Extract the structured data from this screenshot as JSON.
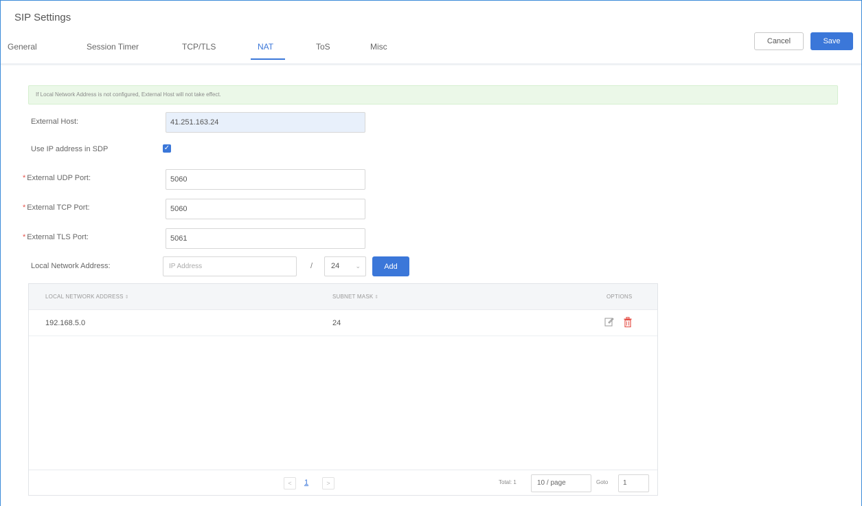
{
  "page": {
    "title": "SIP Settings"
  },
  "tabs": [
    {
      "label": "General"
    },
    {
      "label": "Session Timer"
    },
    {
      "label": "TCP/TLS"
    },
    {
      "label": "NAT"
    },
    {
      "label": "ToS"
    },
    {
      "label": "Misc"
    }
  ],
  "active_tab": "NAT",
  "actions": {
    "cancel_label": "Cancel",
    "save_label": "Save"
  },
  "notice": "If Local Network Address is not configured, External Host will not take effect.",
  "form": {
    "external_host": {
      "label": "External Host:",
      "value": "41.251.163.24"
    },
    "use_ip_sdp": {
      "label": "Use IP address in SDP",
      "checked": true
    },
    "udp_port": {
      "required_mark": "*",
      "label": "External UDP Port:",
      "value": "5060"
    },
    "tcp_port": {
      "required_mark": "*",
      "label": "External TCP Port:",
      "value": "5060"
    },
    "tls_port": {
      "required_mark": "*",
      "label": "External TLS Port:",
      "value": "5061"
    },
    "local_network": {
      "label": "Local Network Address:",
      "ip_placeholder": "IP Address",
      "separator": "/",
      "mask_value": "24",
      "add_label": "Add"
    }
  },
  "table": {
    "columns": [
      "LOCAL NETWORK ADDRESS",
      "SUBNET MASK",
      "OPTIONS"
    ],
    "rows": [
      {
        "address": "192.168.5.0",
        "mask": "24"
      }
    ],
    "pagination": {
      "prev": "<",
      "current_page": "1",
      "next": ">",
      "total_text": "Total: 1",
      "page_size": "10 / page",
      "goto_label": "Goto",
      "goto_value": "1"
    }
  },
  "icons": {
    "sort": "sort-icon",
    "edit": "edit-icon",
    "delete": "trash-icon",
    "check": "check-icon"
  },
  "colors": {
    "accent": "#3b77d9",
    "danger": "#e5534b",
    "notice_bg": "#ebf8e8"
  }
}
